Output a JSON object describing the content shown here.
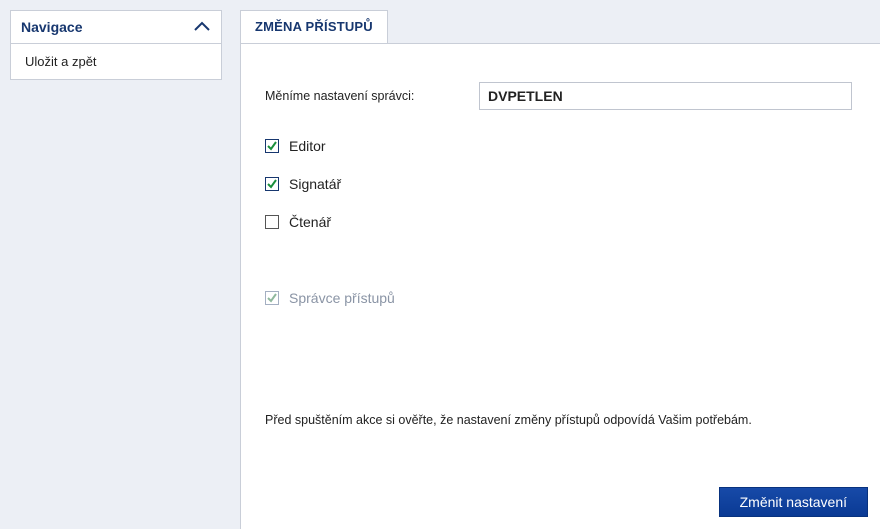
{
  "sidebar": {
    "title": "Navigace",
    "items": [
      "Uložit a zpět"
    ]
  },
  "main": {
    "tab_label": "ZMĚNA PŘÍSTUPŮ",
    "admin_label": "Měníme nastavení správci:",
    "admin_value": "DVPETLEN",
    "roles": {
      "editor": {
        "label": "Editor",
        "checked": true,
        "disabled": false
      },
      "signatar": {
        "label": "Signatář",
        "checked": true,
        "disabled": false
      },
      "ctenar": {
        "label": "Čtenář",
        "checked": false,
        "disabled": false
      },
      "spravce": {
        "label": "Správce přístupů",
        "checked": true,
        "disabled": true
      }
    },
    "notice": "Před spuštěním akce si ověřte, že nastavení změny přístupů odpovídá Vašim potřebám.",
    "submit_label": "Změnit nastavení"
  }
}
